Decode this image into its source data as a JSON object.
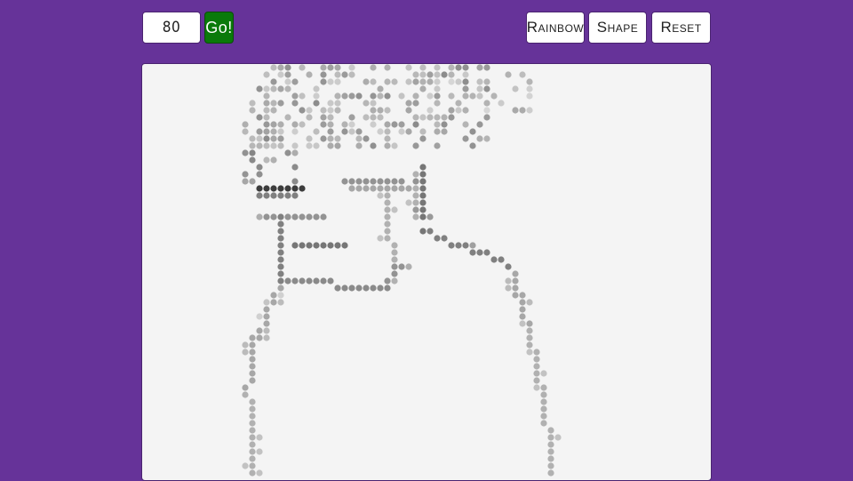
{
  "toolbar": {
    "grid_size_value": "80",
    "go_label": "Go!",
    "rainbow_label": "Rainbow",
    "shape_label": "Shape",
    "reset_label": "Reset"
  },
  "colors": {
    "background": "#663399",
    "canvas": "#f4f4f4",
    "go_button": "#0a7a0a",
    "dot_light": "#d6d6d6",
    "dot_mid": "#a8a8a8",
    "dot_dark": "#5a5a5a"
  }
}
